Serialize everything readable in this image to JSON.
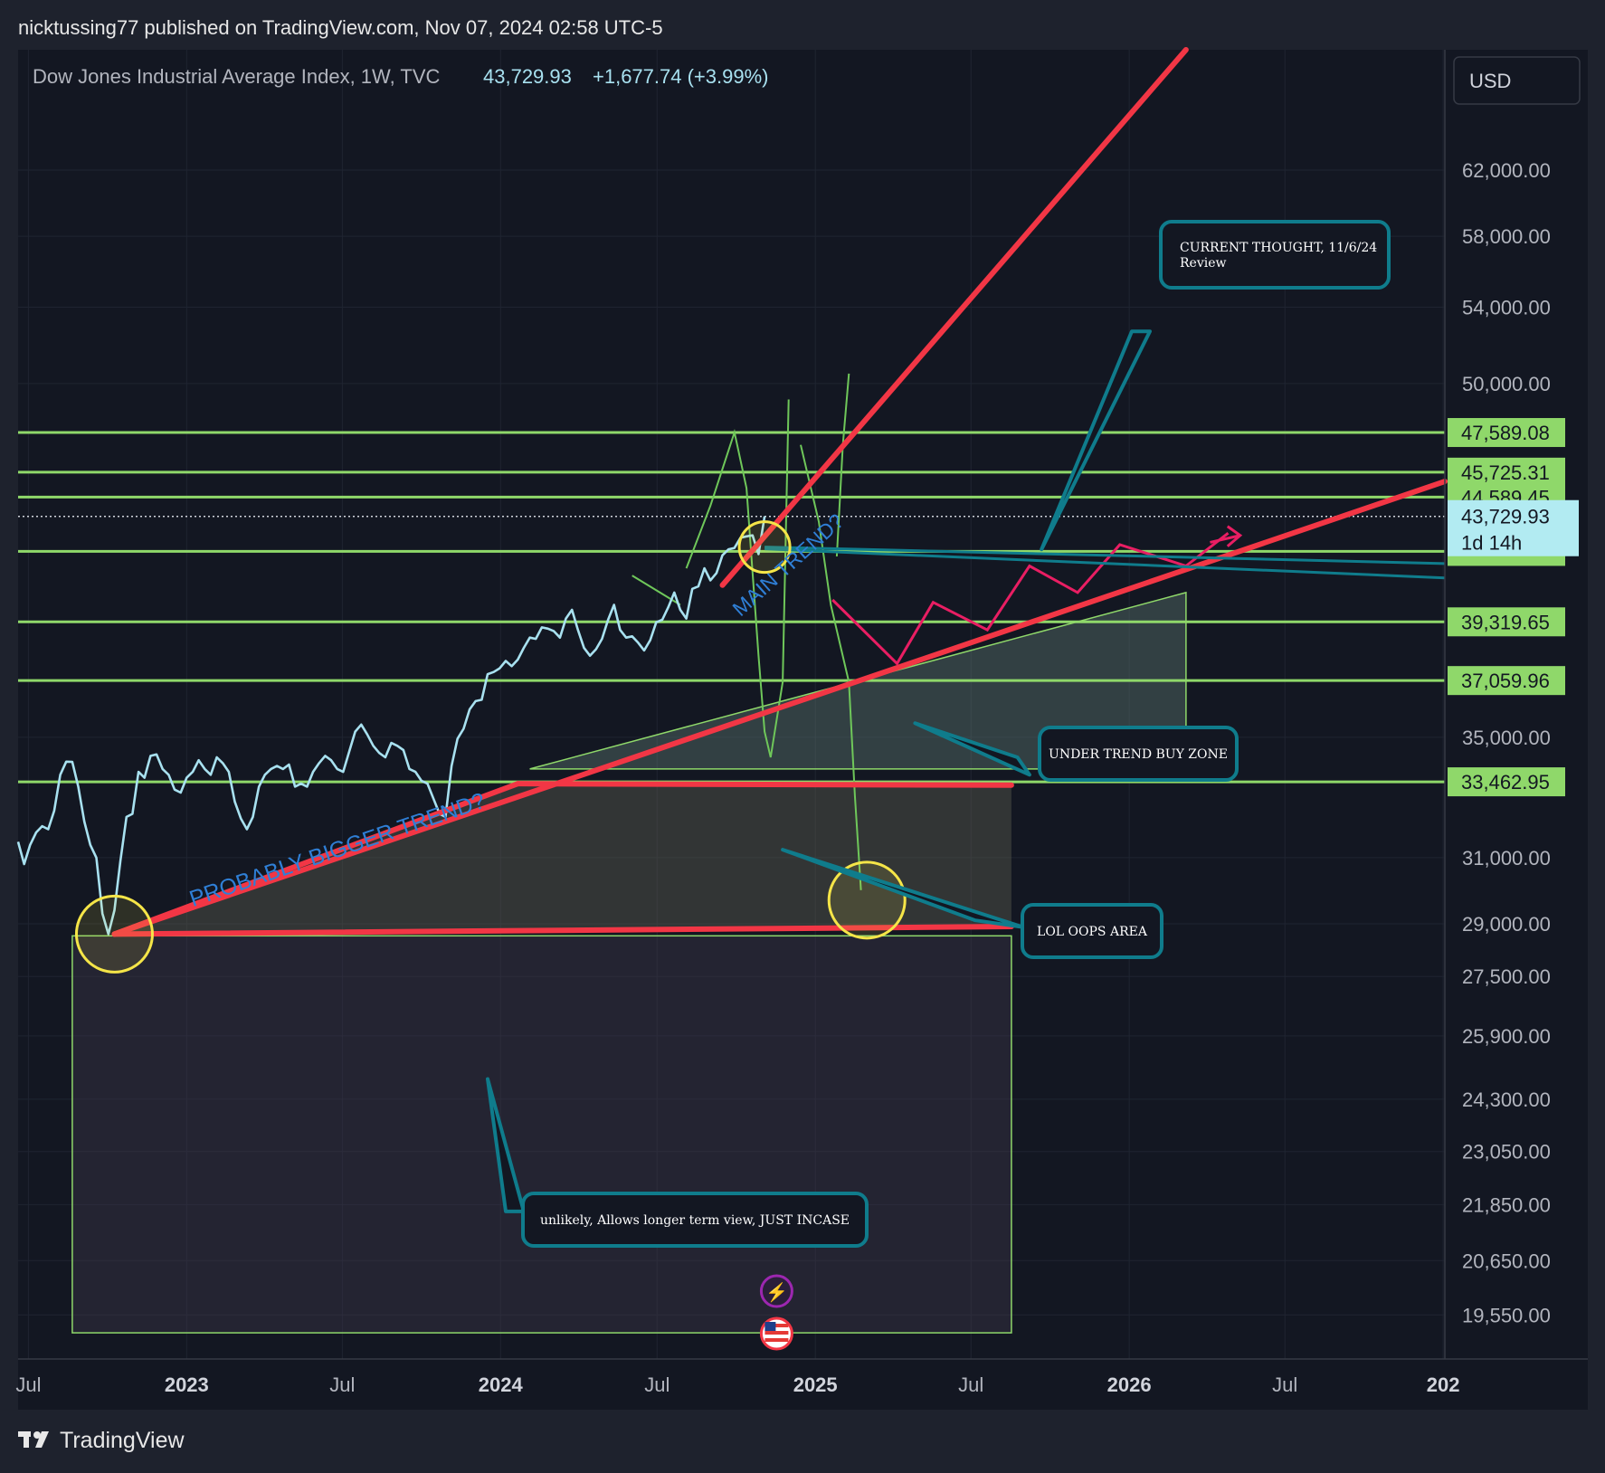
{
  "header": {
    "published_by": "nicktussing77 published on TradingView.com, Nov 07, 2024 02:58 UTC-5"
  },
  "legend": {
    "symbol": "Dow Jones Industrial Average Index, 1W, TVC",
    "last_price": "43,729.93",
    "change": "+1,677.74 (+3.99%)"
  },
  "currency_button": "USD",
  "footer": {
    "brand": "TradingView"
  },
  "colors": {
    "background": "#131722",
    "price_line": "#a8e1f0",
    "level_line": "#8fd86a",
    "trend_red": "#f23645",
    "projection": "#e91e63",
    "callout": "#0f7c8c",
    "circle": "#f5e548",
    "trend_label": "#2f7fd6"
  },
  "chart_data": {
    "type": "line",
    "title": "",
    "ylabel": "",
    "xlabel": "",
    "scale": "log",
    "ylim": [
      18700,
      70000
    ],
    "xlim": [
      "2022-06-19",
      "2027-01-03"
    ],
    "grid": true,
    "y_ticks": [
      "62,000.00",
      "58,000.00",
      "54,000.00",
      "50,000.00",
      "35,000.00",
      "31,000.00",
      "29,000.00",
      "27,500.00",
      "25,900.00",
      "24,300.00",
      "23,050.00",
      "21,850.00",
      "20,650.00",
      "19,550.00"
    ],
    "x_ticks": [
      {
        "label": "Jul",
        "date": "2022-07-01",
        "major": false
      },
      {
        "label": "2023",
        "date": "2023-01-01",
        "major": true
      },
      {
        "label": "Jul",
        "date": "2023-07-01",
        "major": false
      },
      {
        "label": "2024",
        "date": "2024-01-01",
        "major": true
      },
      {
        "label": "Jul",
        "date": "2024-07-01",
        "major": false
      },
      {
        "label": "2025",
        "date": "2025-01-01",
        "major": true
      },
      {
        "label": "Jul",
        "date": "2025-07-01",
        "major": false
      },
      {
        "label": "2026",
        "date": "2026-01-01",
        "major": true
      },
      {
        "label": "Jul",
        "date": "2026-07-01",
        "major": false
      },
      {
        "label": "202",
        "date": "2027-01-01",
        "major": true
      }
    ],
    "series": [
      {
        "x": [
          "2022-06-19",
          "2022-06-26",
          "2022-07-03",
          "2022-07-10",
          "2022-07-17",
          "2022-07-24",
          "2022-07-31",
          "2022-08-07",
          "2022-08-14",
          "2022-08-21",
          "2022-08-28",
          "2022-09-04",
          "2022-09-11",
          "2022-09-18",
          "2022-09-25",
          "2022-10-02",
          "2022-10-09",
          "2022-10-16",
          "2022-10-23",
          "2022-10-30",
          "2022-11-06",
          "2022-11-13",
          "2022-11-20",
          "2022-11-27",
          "2022-12-04",
          "2022-12-11",
          "2022-12-18",
          "2022-12-25",
          "2023-01-01",
          "2023-01-08",
          "2023-01-15",
          "2023-01-22",
          "2023-01-29",
          "2023-02-05",
          "2023-02-12",
          "2023-02-19",
          "2023-02-26",
          "2023-03-05",
          "2023-03-12",
          "2023-03-19",
          "2023-03-26",
          "2023-04-02",
          "2023-04-09",
          "2023-04-16",
          "2023-04-23",
          "2023-04-30",
          "2023-05-07",
          "2023-05-14",
          "2023-05-21",
          "2023-05-28",
          "2023-06-04",
          "2023-06-11",
          "2023-06-18",
          "2023-06-25",
          "2023-07-02",
          "2023-07-09",
          "2023-07-16",
          "2023-07-23",
          "2023-07-30",
          "2023-08-06",
          "2023-08-13",
          "2023-08-20",
          "2023-08-27",
          "2023-09-03",
          "2023-09-10",
          "2023-09-17",
          "2023-09-24",
          "2023-10-01",
          "2023-10-08",
          "2023-10-15",
          "2023-10-22",
          "2023-10-29",
          "2023-11-05",
          "2023-11-12",
          "2023-11-19",
          "2023-11-26",
          "2023-12-03",
          "2023-12-10",
          "2023-12-17",
          "2023-12-24",
          "2023-12-31",
          "2024-01-07",
          "2024-01-14",
          "2024-01-21",
          "2024-01-28",
          "2024-02-04",
          "2024-02-11",
          "2024-02-18",
          "2024-02-25",
          "2024-03-03",
          "2024-03-10",
          "2024-03-17",
          "2024-03-24",
          "2024-03-31",
          "2024-04-07",
          "2024-04-14",
          "2024-04-21",
          "2024-04-28",
          "2024-05-05",
          "2024-05-12",
          "2024-05-19",
          "2024-05-26",
          "2024-06-02",
          "2024-06-09",
          "2024-06-16",
          "2024-06-23",
          "2024-06-30",
          "2024-07-07",
          "2024-07-14",
          "2024-07-21",
          "2024-07-28",
          "2024-08-04",
          "2024-08-11",
          "2024-08-18",
          "2024-08-25",
          "2024-09-01",
          "2024-09-08",
          "2024-09-15",
          "2024-09-22",
          "2024-09-29",
          "2024-10-06",
          "2024-10-13",
          "2024-10-20",
          "2024-10-27",
          "2024-11-03"
        ],
        "y": [
          31500,
          30800,
          31400,
          31800,
          32000,
          31900,
          32500,
          33700,
          34150,
          34140,
          33300,
          32150,
          31400,
          31000,
          29300,
          28700,
          29400,
          30900,
          32300,
          32400,
          33800,
          33600,
          34350,
          34400,
          33900,
          33700,
          33200,
          33100,
          33600,
          33800,
          34200,
          33900,
          33700,
          34300,
          34100,
          33800,
          32800,
          32250,
          31900,
          32300,
          33300,
          33700,
          33900,
          34000,
          33900,
          34050,
          33300,
          33400,
          33300,
          33800,
          34100,
          34350,
          34200,
          33900,
          33800,
          34500,
          35200,
          35450,
          35100,
          34700,
          34450,
          34300,
          34800,
          34700,
          34550,
          33900,
          33800,
          33500,
          33400,
          32900,
          32400,
          32300,
          34000,
          34950,
          35300,
          36000,
          36300,
          36350,
          37300,
          37380,
          37520,
          37800,
          37600,
          37850,
          38300,
          38700,
          38650,
          39100,
          39050,
          38950,
          38700,
          39450,
          39800,
          39000,
          38300,
          38000,
          38250,
          38650,
          39400,
          40000,
          39000,
          38700,
          38750,
          38500,
          38200,
          38600,
          39300,
          39400,
          39900,
          40500,
          39800,
          39450,
          40650,
          40750,
          41500,
          41000,
          41300,
          42050,
          42300,
          42360,
          42800,
          42860,
          42900,
          42100,
          43729.93
        ]
      }
    ],
    "horizontal_levels": [
      {
        "label": "47,589.08",
        "value": 47589.08,
        "shown": true
      },
      {
        "label": "45,725.31",
        "value": 45725.31,
        "shown": true
      },
      {
        "label": "44,589.45",
        "value": 44589.45,
        "shown": true
      },
      {
        "label": "42,213.33",
        "value": 42213.33,
        "shown": false
      },
      {
        "label": "39,319.65",
        "value": 39319.65,
        "shown": true
      },
      {
        "label": "37,059.96",
        "value": 37059.96,
        "shown": true
      },
      {
        "label": "33,462.95",
        "value": 33462.95,
        "shown": true
      }
    ],
    "last_price_label": {
      "value": 43729.93,
      "text": "43,729.93",
      "countdown": "1d 14h"
    },
    "trend_lines": [
      {
        "name": "bigger-trend",
        "from": {
          "x": "2022-10-09",
          "y": 28700
        },
        "to": {
          "x": "2027-01-03",
          "y": 45300
        }
      },
      {
        "name": "main-trend",
        "from": {
          "x": "2024-09-15",
          "y": 40800
        },
        "to": {
          "x": "2026-03-08",
          "y": 70000
        }
      },
      {
        "name": "oops-upper",
        "from": {
          "x": "2022-10-09",
          "y": 28700
        },
        "to": {
          "x": "2024-01-21",
          "y": 33400
        }
      },
      {
        "name": "oops-top",
        "from": {
          "x": "2024-01-21",
          "y": 33400
        },
        "to": {
          "x": "2025-08-17",
          "y": 33350
        }
      },
      {
        "name": "oops-bottom",
        "from": {
          "x": "2022-10-09",
          "y": 28700
        },
        "to": {
          "x": "2025-08-17",
          "y": 28920
        }
      }
    ],
    "zones": [
      {
        "name": "long-term-view-box",
        "x": [
          "2022-08-21",
          "2025-08-17"
        ],
        "y": [
          19200,
          28650
        ]
      },
      {
        "name": "oops-zone",
        "x": [
          "2022-10-09",
          "2025-08-17"
        ],
        "y": [
          28700,
          33400
        ]
      }
    ],
    "buy_zone": {
      "name": "under-trend-buy-zone",
      "points": [
        {
          "x": "2024-02-04",
          "y": 33900
        },
        {
          "x": "2026-03-08",
          "y": 40500
        },
        {
          "x": "2026-03-08",
          "y": 33900
        }
      ]
    },
    "projection_path": [
      {
        "x": "2025-01-21",
        "y": 40200
      },
      {
        "x": "2025-04-06",
        "y": 37700
      },
      {
        "x": "2025-05-18",
        "y": 40100
      },
      {
        "x": "2025-07-20",
        "y": 39000
      },
      {
        "x": "2025-09-07",
        "y": 41600
      },
      {
        "x": "2025-11-02",
        "y": 40500
      },
      {
        "x": "2025-12-21",
        "y": 42500
      },
      {
        "x": "2026-03-08",
        "y": 41600
      },
      {
        "x": "2026-04-26",
        "y": 43000
      }
    ],
    "projection_arrow": {
      "from": {
        "x": "2026-04-05",
        "y": 42600
      },
      "to": {
        "x": "2026-05-10",
        "y": 42900
      }
    },
    "sketch_lines": [
      [
        {
          "x": "2024-08-04",
          "y": 41500
        },
        {
          "x": "2024-09-01",
          "y": 44200
        },
        {
          "x": "2024-09-29",
          "y": 47600
        },
        {
          "x": "2024-10-13",
          "y": 45000
        },
        {
          "x": "2024-10-27",
          "y": 38000
        },
        {
          "x": "2024-11-03",
          "y": 35200
        },
        {
          "x": "2024-11-10",
          "y": 34300
        },
        {
          "x": "2024-11-24",
          "y": 37000
        },
        {
          "x": "2024-12-01",
          "y": 49200
        }
      ],
      [
        {
          "x": "2024-12-15",
          "y": 47000
        },
        {
          "x": "2025-01-05",
          "y": 43500
        },
        {
          "x": "2025-01-19",
          "y": 40000
        },
        {
          "x": "2025-02-09",
          "y": 37000
        },
        {
          "x": "2025-02-16",
          "y": 33000
        },
        {
          "x": "2025-02-23",
          "y": 30000
        }
      ],
      [
        {
          "x": "2025-01-26",
          "y": 42000
        },
        {
          "x": "2025-02-02",
          "y": 47000
        },
        {
          "x": "2025-02-09",
          "y": 50500
        }
      ],
      [
        {
          "x": "2024-06-02",
          "y": 41200
        },
        {
          "x": "2024-07-28",
          "y": 40000
        }
      ]
    ],
    "callout_pointers": [
      {
        "name": "current-thought",
        "tip": {
          "x": "2025-09-21",
          "y": 42300
        },
        "base": [
          {
            "x": "2026-01-04",
            "y": 52700
          },
          {
            "x": "2026-01-25",
            "y": 52700
          }
        ]
      },
      {
        "name": "buy-zone",
        "tip": {
          "x": "2025-04-27",
          "y": 35500
        },
        "base": [
          {
            "x": "2025-08-24",
            "y": 34300
          },
          {
            "x": "2025-09-07",
            "y": 33700
          }
        ]
      },
      {
        "name": "oops",
        "tip": {
          "x": "2024-11-24",
          "y": 31250
        },
        "base": [
          {
            "x": "2025-07-06",
            "y": 29100
          },
          {
            "x": "2025-08-31",
            "y": 28900
          }
        ]
      },
      {
        "name": "unlikely",
        "tip": {
          "x": "2023-12-17",
          "y": 24800
        },
        "base": [
          {
            "x": "2024-01-07",
            "y": 21700
          },
          {
            "x": "2024-01-28",
            "y": 21700
          }
        ]
      }
    ],
    "circles": [
      {
        "name": "low-circle",
        "x": "2022-10-09",
        "y": 28700
      },
      {
        "name": "current-circle",
        "x": "2024-11-03",
        "y": 42400
      },
      {
        "name": "oops-circle",
        "x": "2025-03-02",
        "y": 29700
      }
    ],
    "annotations": {
      "current_thought": "CURRENT THOUGHT, 11/6/24\nReview",
      "buy_zone": "UNDER TREND BUY ZONE",
      "oops": "LOL OOPS AREA",
      "unlikely": "unlikely, Allows longer term view, JUST INCASE",
      "bigger_trend": "PROBABLY BIGGER TREND?",
      "main_trend": "MAIN TREND?"
    },
    "event_markers": [
      {
        "name": "flash-event",
        "x": "2024-11-17",
        "glyph": "⚡"
      },
      {
        "name": "us-flag-event",
        "x": "2024-11-17",
        "glyph": "us-flag"
      }
    ]
  }
}
